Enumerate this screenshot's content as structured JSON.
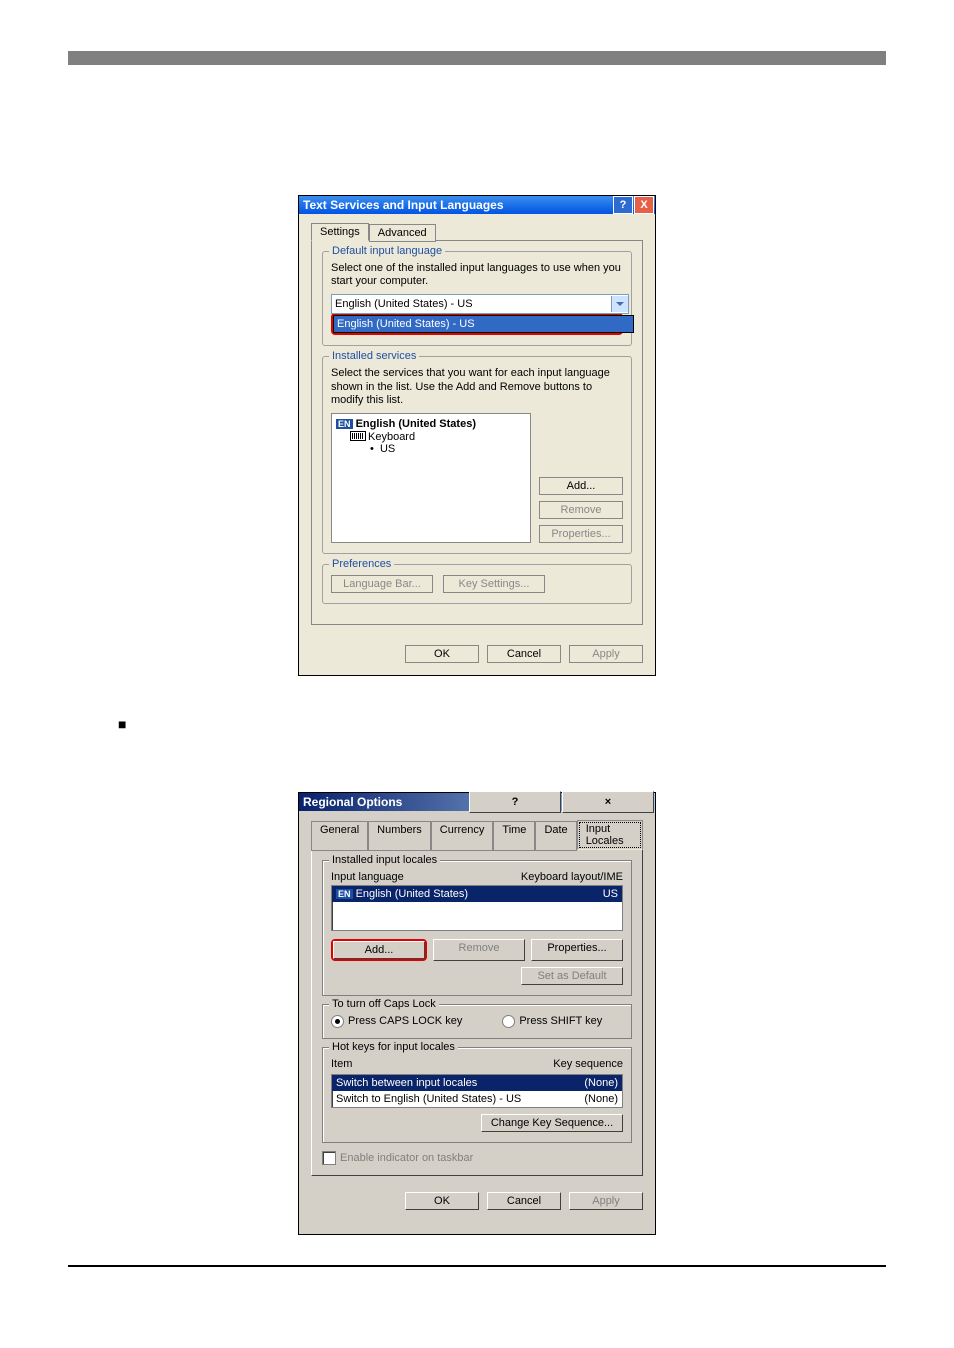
{
  "dialog1": {
    "title": "Text Services and Input Languages",
    "tabs": {
      "settings": "Settings",
      "advanced": "Advanced"
    },
    "default_lang": {
      "legend": "Default input language",
      "desc": "Select one of the installed input languages to use when you start your computer.",
      "combo_value": "English (United States) - US",
      "dropdown_value": "English (United States) - US"
    },
    "installed": {
      "legend": "Installed services",
      "desc": "Select the services that you want for each input language shown in the list. Use the Add and Remove buttons to modify this list.",
      "lang_badge": "EN",
      "lang_name": "English (United States)",
      "keyboard_label": "Keyboard",
      "layout": "US",
      "buttons": {
        "add": "Add...",
        "remove": "Remove",
        "properties": "Properties..."
      }
    },
    "prefs": {
      "legend": "Preferences",
      "language_bar": "Language Bar...",
      "key_settings": "Key Settings..."
    },
    "footer": {
      "ok": "OK",
      "cancel": "Cancel",
      "apply": "Apply"
    }
  },
  "separator_bullet": "■",
  "dialog2": {
    "title": "Regional Options",
    "tabs": {
      "general": "General",
      "numbers": "Numbers",
      "currency": "Currency",
      "time": "Time",
      "date": "Date",
      "input_locales": "Input Locales"
    },
    "installed": {
      "legend": "Installed input locales",
      "col1": "Input language",
      "col2": "Keyboard layout/IME",
      "row_badge": "EN",
      "row_lang": "English (United States)",
      "row_kbd": "US",
      "buttons": {
        "add": "Add...",
        "remove": "Remove",
        "properties": "Properties...",
        "set_default": "Set as Default"
      }
    },
    "capslock": {
      "legend": "To turn off Caps Lock",
      "opt1": "Press CAPS LOCK key",
      "opt2": "Press SHIFT key"
    },
    "hotkeys": {
      "legend": "Hot keys for input locales",
      "col1": "Item",
      "col2": "Key sequence",
      "row1_item": "Switch between input locales",
      "row1_seq": "(None)",
      "row2_item": "Switch to English (United States) - US",
      "row2_seq": "(None)",
      "change_btn": "Change Key Sequence..."
    },
    "indicator": "Enable indicator on taskbar",
    "footer": {
      "ok": "OK",
      "cancel": "Cancel",
      "apply": "Apply"
    }
  }
}
